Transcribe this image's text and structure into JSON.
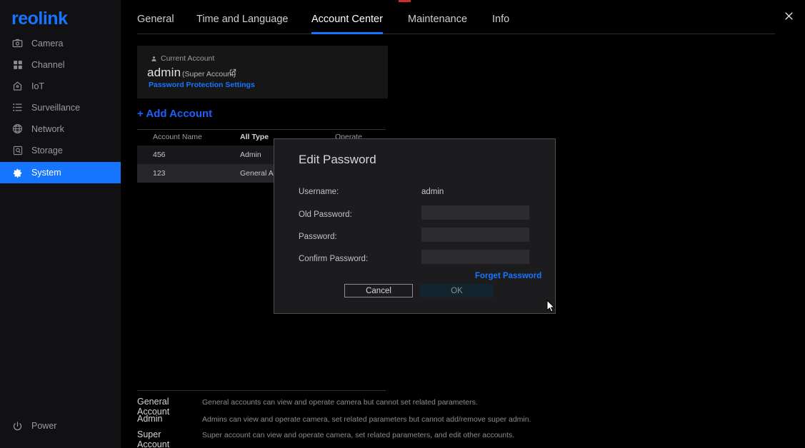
{
  "brand": {
    "logo_text": "reolink",
    "accent": "#1675ff"
  },
  "sidebar": {
    "items": [
      {
        "label": "Camera",
        "icon": "camera-icon",
        "active": false
      },
      {
        "label": "Channel",
        "icon": "channel-icon",
        "active": false
      },
      {
        "label": "IoT",
        "icon": "iot-icon",
        "active": false
      },
      {
        "label": "Surveillance",
        "icon": "surveillance-icon",
        "active": false
      },
      {
        "label": "Network",
        "icon": "network-icon",
        "active": false
      },
      {
        "label": "Storage",
        "icon": "storage-icon",
        "active": false
      },
      {
        "label": "System",
        "icon": "gear-icon",
        "active": true
      }
    ],
    "power": {
      "label": "Power",
      "icon": "power-icon"
    }
  },
  "window": {
    "close_icon": "close-icon"
  },
  "tabs": [
    {
      "label": "General",
      "active": false
    },
    {
      "label": "Time and Language",
      "active": false
    },
    {
      "label": "Account Center",
      "active": true
    },
    {
      "label": "Maintenance",
      "active": false
    },
    {
      "label": "Info",
      "active": false
    }
  ],
  "current_account": {
    "card_label": "Current Account",
    "user_icon": "user-icon",
    "name": "admin",
    "role": "(Super Account)",
    "edit_icon": "edit-external-link-icon",
    "link": "Password Protection Settings"
  },
  "add_account": {
    "label": "+ Add Account"
  },
  "table": {
    "columns": [
      "Account Name",
      "All Type",
      "Operate"
    ],
    "type_filter_icon": "chevron-down-icon",
    "rows": [
      {
        "name": "456",
        "type": "Admin"
      },
      {
        "name": "123",
        "type": "General Account"
      }
    ]
  },
  "legend": [
    {
      "title": "General Account",
      "desc": "General accounts can view and operate camera but cannot set related parameters."
    },
    {
      "title": "Admin",
      "desc": "Admins can view and operate camera, set related parameters but cannot add/remove super admin."
    },
    {
      "title": "Super Account",
      "desc": "Super account can view and operate camera, set related parameters, and edit other accounts."
    }
  ],
  "dialog": {
    "title": "Edit Password",
    "fields": {
      "username_label": "Username:",
      "username_value": "admin",
      "old_password_label": "Old Password:",
      "old_password_value": "",
      "password_label": "Password:",
      "password_value": "",
      "confirm_password_label": "Confirm Password:",
      "confirm_password_value": ""
    },
    "forget_link": "Forget Password",
    "cancel_label": "Cancel",
    "ok_label": "OK"
  }
}
